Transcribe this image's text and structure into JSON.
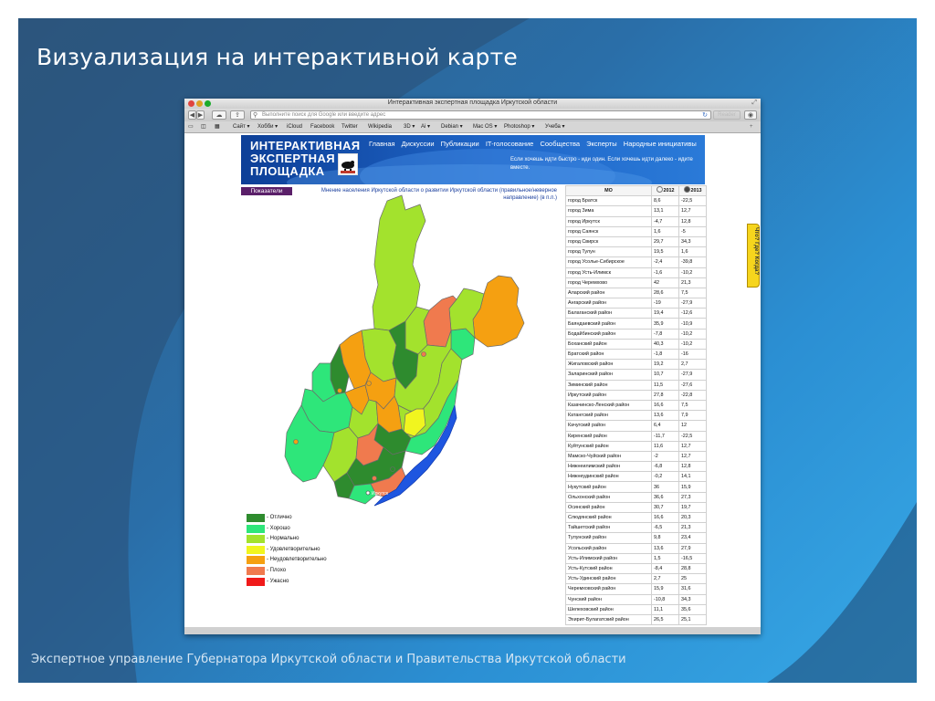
{
  "slide": {
    "title": "Визуализация на интерактивной карте",
    "footer": "Экспертное управление Губернатора Иркутской области и Правительства Иркутской области"
  },
  "browser": {
    "window_title": "Интерактивная экспертная площадка Иркутской области",
    "address_placeholder": "Выполните поиск для Google или введите адрес",
    "reader_label": "Reader",
    "bookmarks": [
      "Сайт ▾",
      "Хобби ▾",
      "iCloud",
      "Facebook",
      "Twitter",
      "Wikipedia",
      "3D ▾",
      "Ai ▾",
      "Debian ▾",
      "Mac OS ▾",
      "Photoshop ▾",
      "Учеба ▾"
    ]
  },
  "site": {
    "logo_lines": [
      "ИНТЕРАКТИВНАЯ",
      "ЭКСПЕРТНАЯ",
      "ПЛОЩАДКА"
    ],
    "nav": [
      "Главная",
      "Дискуссии",
      "Публикации",
      "IT-голосование",
      "Сообщества",
      "Эксперты",
      "Народные инициативы"
    ],
    "banner_note": "Если хочешь идти быстро - иди один. Если хочешь идти далеко - идите вместе.",
    "indicators_button": "Показатели",
    "map_caption": "Мнение населения Иркутской области о развитии Иркутской области (правильное/неверное направление) (в п.п.)",
    "city_label": "Иркутск",
    "side_tab": "Что? Где? Когда?"
  },
  "legend": [
    {
      "label": "- Отлично",
      "color": "#2e8b2e"
    },
    {
      "label": "- Хорошо",
      "color": "#2ee67a"
    },
    {
      "label": "- Нормально",
      "color": "#a3e22d"
    },
    {
      "label": "- Удовлетворительно",
      "color": "#f1f51f"
    },
    {
      "label": "- Неудовлетворительно",
      "color": "#f5a011"
    },
    {
      "label": "- Плохо",
      "color": "#f07a4e"
    },
    {
      "label": "- Ужасно",
      "color": "#f01a1a"
    }
  ],
  "table": {
    "headers": [
      "МО",
      "2012",
      "2013"
    ],
    "selected_year": "2013",
    "rows": [
      [
        "город Братск",
        "8,6",
        "-22,5"
      ],
      [
        "город Зима",
        "13,1",
        "12,7"
      ],
      [
        "город Иркутск",
        "-4,7",
        "12,8"
      ],
      [
        "город Саянск",
        "1,6",
        "-5"
      ],
      [
        "город Свирск",
        "29,7",
        "34,3"
      ],
      [
        "город Тулун",
        "19,5",
        "1,6"
      ],
      [
        "город Усолье-Сибирское",
        "-2,4",
        "-39,8"
      ],
      [
        "город Усть-Илимск",
        "-1,6",
        "-10,2"
      ],
      [
        "город Черемхово",
        "42",
        "21,3"
      ],
      [
        "Аларский район",
        "28,6",
        "7,5"
      ],
      [
        "Ангарский район",
        "-19",
        "-27,9"
      ],
      [
        "Балаганский район",
        "19,4",
        "-12,6"
      ],
      [
        "Баяндаевский район",
        "35,9",
        "-10,9"
      ],
      [
        "Бодайбинский район",
        "-7,8",
        "-10,2"
      ],
      [
        "Боханский район",
        "40,3",
        "-10,2"
      ],
      [
        "Братский район",
        "-1,8",
        "-16"
      ],
      [
        "Жигаловский район",
        "19,2",
        "2,7"
      ],
      [
        "Заларинский район",
        "10,7",
        "-27,9"
      ],
      [
        "Зиминский район",
        "11,5",
        "-27,6"
      ],
      [
        "Иркутский район",
        "27,8",
        "-22,8"
      ],
      [
        "Казачинско-Ленский район",
        "16,6",
        "7,5"
      ],
      [
        "Катангский район",
        "13,6",
        "7,9"
      ],
      [
        "Качугский район",
        "6,4",
        "12"
      ],
      [
        "Киренский район",
        "-11,7",
        "-22,5"
      ],
      [
        "Куйтунский район",
        "11,6",
        "12,7"
      ],
      [
        "Мамско-Чуйский район",
        "-2",
        "12,7"
      ],
      [
        "Нижнеилимский район",
        "-6,8",
        "12,8"
      ],
      [
        "Нижнеудинский район",
        "-0,2",
        "14,1"
      ],
      [
        "Нукутский район",
        "36",
        "15,9"
      ],
      [
        "Ольхонский район",
        "36,6",
        "27,3"
      ],
      [
        "Осинский район",
        "30,7",
        "19,7"
      ],
      [
        "Слюдянский район",
        "16,6",
        "20,3"
      ],
      [
        "Тайшетский район",
        "-6,5",
        "21,3"
      ],
      [
        "Тулунский район",
        "9,8",
        "23,4"
      ],
      [
        "Усольский район",
        "13,6",
        "27,9"
      ],
      [
        "Усть-Илимский район",
        "1,5",
        "-16,5"
      ],
      [
        "Усть-Кутский район",
        "-8,4",
        "28,8"
      ],
      [
        "Усть-Удинский район",
        "2,7",
        "25"
      ],
      [
        "Черемховский район",
        "15,9",
        "31,6"
      ],
      [
        "Чунский район",
        "-10,8",
        "34,3"
      ],
      [
        "Шелеховский район",
        "11,1",
        "35,6"
      ],
      [
        "Эхирит-Булагатский район",
        "26,5",
        "25,1"
      ]
    ]
  }
}
